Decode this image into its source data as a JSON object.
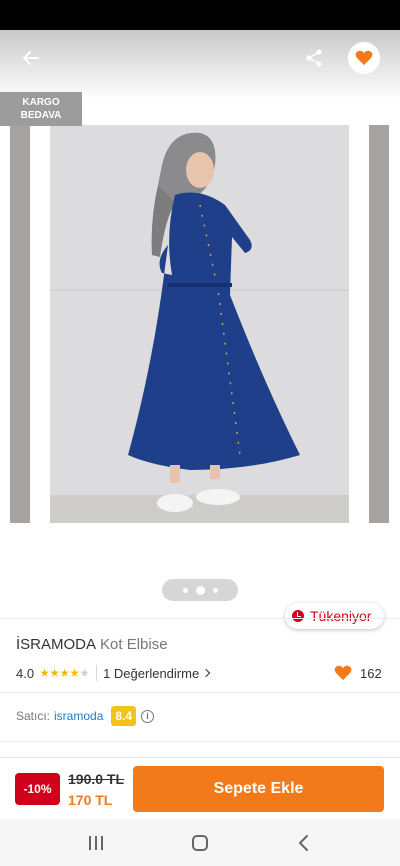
{
  "colors": {
    "accent": "#f27a1a",
    "discount": "#d0021b",
    "seller_score": "#f0c419",
    "link": "#2a7ac0"
  },
  "gallery": {
    "badge_line1": "KARGO",
    "badge_line2": "BEDAVA",
    "stock_label": "Tükeniyor",
    "pages": 3,
    "active_page": 2
  },
  "product": {
    "brand": "İSRAMODA",
    "name": "Kot Elbise",
    "rating": "4.0",
    "rating_stars": 4,
    "reviews_label": "1 Değerlendirme",
    "favorites": "162"
  },
  "seller": {
    "label": "Satıcı:",
    "name": "isramoda",
    "score": "8.4"
  },
  "purchase": {
    "discount": "-10%",
    "old_price": "190.0 TL",
    "new_price": "170 TL",
    "add_to_cart": "Sepete Ekle"
  },
  "icons": [
    "back-arrow-icon",
    "share-icon",
    "heart-icon",
    "clock-icon",
    "star-icon",
    "chevron-right-icon",
    "info-icon",
    "recents-icon",
    "home-icon",
    "back-icon"
  ]
}
